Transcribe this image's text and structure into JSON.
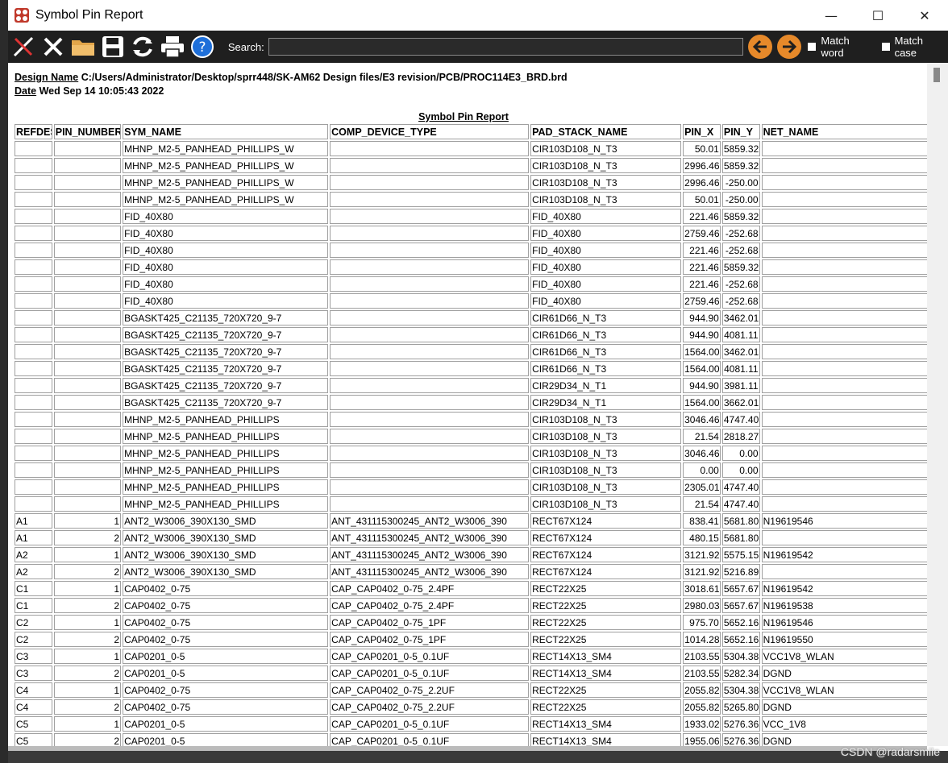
{
  "window": {
    "title": "Symbol Pin Report"
  },
  "toolbar": {
    "search_label": "Search:",
    "search_value": "",
    "match_word_label": "Match word",
    "match_case_label": "Match case"
  },
  "report": {
    "design_name_label": "Design Name",
    "design_name_value": "C:/Users/Administrator/Desktop/sprr448/SK-AM62 Design files/E3 revision/PCB/PROC114E3_BRD.brd",
    "date_label": "Date",
    "date_value": "Wed Sep 14 10:05:43 2022",
    "title": "Symbol Pin Report",
    "columns": [
      "REFDES",
      "PIN_NUMBER",
      "SYM_NAME",
      "COMP_DEVICE_TYPE",
      "PAD_STACK_NAME",
      "PIN_X",
      "PIN_Y",
      "NET_NAME"
    ],
    "rows": [
      [
        "",
        "",
        "MHNP_M2-5_PANHEAD_PHILLIPS_W",
        "",
        "CIR103D108_N_T3",
        "50.01",
        "5859.32",
        ""
      ],
      [
        "",
        "",
        "MHNP_M2-5_PANHEAD_PHILLIPS_W",
        "",
        "CIR103D108_N_T3",
        "2996.46",
        "5859.32",
        ""
      ],
      [
        "",
        "",
        "MHNP_M2-5_PANHEAD_PHILLIPS_W",
        "",
        "CIR103D108_N_T3",
        "2996.46",
        "-250.00",
        ""
      ],
      [
        "",
        "",
        "MHNP_M2-5_PANHEAD_PHILLIPS_W",
        "",
        "CIR103D108_N_T3",
        "50.01",
        "-250.00",
        ""
      ],
      [
        "",
        "",
        "FID_40X80",
        "",
        "FID_40X80",
        "221.46",
        "5859.32",
        ""
      ],
      [
        "",
        "",
        "FID_40X80",
        "",
        "FID_40X80",
        "2759.46",
        "-252.68",
        ""
      ],
      [
        "",
        "",
        "FID_40X80",
        "",
        "FID_40X80",
        "221.46",
        "-252.68",
        ""
      ],
      [
        "",
        "",
        "FID_40X80",
        "",
        "FID_40X80",
        "221.46",
        "5859.32",
        ""
      ],
      [
        "",
        "",
        "FID_40X80",
        "",
        "FID_40X80",
        "221.46",
        "-252.68",
        ""
      ],
      [
        "",
        "",
        "FID_40X80",
        "",
        "FID_40X80",
        "2759.46",
        "-252.68",
        ""
      ],
      [
        "",
        "",
        "BGASKT425_C21135_720X720_9-7",
        "",
        "CIR61D66_N_T3",
        "944.90",
        "3462.01",
        ""
      ],
      [
        "",
        "",
        "BGASKT425_C21135_720X720_9-7",
        "",
        "CIR61D66_N_T3",
        "944.90",
        "4081.11",
        ""
      ],
      [
        "",
        "",
        "BGASKT425_C21135_720X720_9-7",
        "",
        "CIR61D66_N_T3",
        "1564.00",
        "3462.01",
        ""
      ],
      [
        "",
        "",
        "BGASKT425_C21135_720X720_9-7",
        "",
        "CIR61D66_N_T3",
        "1564.00",
        "4081.11",
        ""
      ],
      [
        "",
        "",
        "BGASKT425_C21135_720X720_9-7",
        "",
        "CIR29D34_N_T1",
        "944.90",
        "3981.11",
        ""
      ],
      [
        "",
        "",
        "BGASKT425_C21135_720X720_9-7",
        "",
        "CIR29D34_N_T1",
        "1564.00",
        "3662.01",
        ""
      ],
      [
        "",
        "",
        "MHNP_M2-5_PANHEAD_PHILLIPS",
        "",
        "CIR103D108_N_T3",
        "3046.46",
        "4747.40",
        ""
      ],
      [
        "",
        "",
        "MHNP_M2-5_PANHEAD_PHILLIPS",
        "",
        "CIR103D108_N_T3",
        "21.54",
        "2818.27",
        ""
      ],
      [
        "",
        "",
        "MHNP_M2-5_PANHEAD_PHILLIPS",
        "",
        "CIR103D108_N_T3",
        "3046.46",
        "0.00",
        ""
      ],
      [
        "",
        "",
        "MHNP_M2-5_PANHEAD_PHILLIPS",
        "",
        "CIR103D108_N_T3",
        "0.00",
        "0.00",
        ""
      ],
      [
        "",
        "",
        "MHNP_M2-5_PANHEAD_PHILLIPS",
        "",
        "CIR103D108_N_T3",
        "2305.01",
        "4747.40",
        ""
      ],
      [
        "",
        "",
        "MHNP_M2-5_PANHEAD_PHILLIPS",
        "",
        "CIR103D108_N_T3",
        "21.54",
        "4747.40",
        ""
      ],
      [
        "A1",
        "1",
        "ANT2_W3006_390X130_SMD",
        "ANT_431115300245_ANT2_W3006_390",
        "RECT67X124",
        "838.41",
        "5681.80",
        "N19619546"
      ],
      [
        "A1",
        "2",
        "ANT2_W3006_390X130_SMD",
        "ANT_431115300245_ANT2_W3006_390",
        "RECT67X124",
        "480.15",
        "5681.80",
        ""
      ],
      [
        "A2",
        "1",
        "ANT2_W3006_390X130_SMD",
        "ANT_431115300245_ANT2_W3006_390",
        "RECT67X124",
        "3121.92",
        "5575.15",
        "N19619542"
      ],
      [
        "A2",
        "2",
        "ANT2_W3006_390X130_SMD",
        "ANT_431115300245_ANT2_W3006_390",
        "RECT67X124",
        "3121.92",
        "5216.89",
        ""
      ],
      [
        "C1",
        "1",
        "CAP0402_0-75",
        "CAP_CAP0402_0-75_2.4PF",
        "RECT22X25",
        "3018.61",
        "5657.67",
        "N19619542"
      ],
      [
        "C1",
        "2",
        "CAP0402_0-75",
        "CAP_CAP0402_0-75_2.4PF",
        "RECT22X25",
        "2980.03",
        "5657.67",
        "N19619538"
      ],
      [
        "C2",
        "1",
        "CAP0402_0-75",
        "CAP_CAP0402_0-75_1PF",
        "RECT22X25",
        "975.70",
        "5652.16",
        "N19619546"
      ],
      [
        "C2",
        "2",
        "CAP0402_0-75",
        "CAP_CAP0402_0-75_1PF",
        "RECT22X25",
        "1014.28",
        "5652.16",
        "N19619550"
      ],
      [
        "C3",
        "1",
        "CAP0201_0-5",
        "CAP_CAP0201_0-5_0.1UF",
        "RECT14X13_SM4",
        "2103.55",
        "5304.38",
        "VCC1V8_WLAN"
      ],
      [
        "C3",
        "2",
        "CAP0201_0-5",
        "CAP_CAP0201_0-5_0.1UF",
        "RECT14X13_SM4",
        "2103.55",
        "5282.34",
        "DGND"
      ],
      [
        "C4",
        "1",
        "CAP0402_0-75",
        "CAP_CAP0402_0-75_2.2UF",
        "RECT22X25",
        "2055.82",
        "5304.38",
        "VCC1V8_WLAN"
      ],
      [
        "C4",
        "2",
        "CAP0402_0-75",
        "CAP_CAP0402_0-75_2.2UF",
        "RECT22X25",
        "2055.82",
        "5265.80",
        "DGND"
      ],
      [
        "C5",
        "1",
        "CAP0201_0-5",
        "CAP_CAP0201_0-5_0.1UF",
        "RECT14X13_SM4",
        "1933.02",
        "5276.36",
        "VCC_1V8"
      ],
      [
        "C5",
        "2",
        "CAP0201_0-5",
        "CAP_CAP0201_0-5_0.1UF",
        "RECT14X13_SM4",
        "1955.06",
        "5276.36",
        "DGND"
      ]
    ]
  },
  "watermark": "CSDN @radarsmile",
  "colors": {
    "toolbar_bg": "#1f1f1f",
    "arrow_orange": "#e6892a",
    "help_blue": "#1e6fd9"
  }
}
